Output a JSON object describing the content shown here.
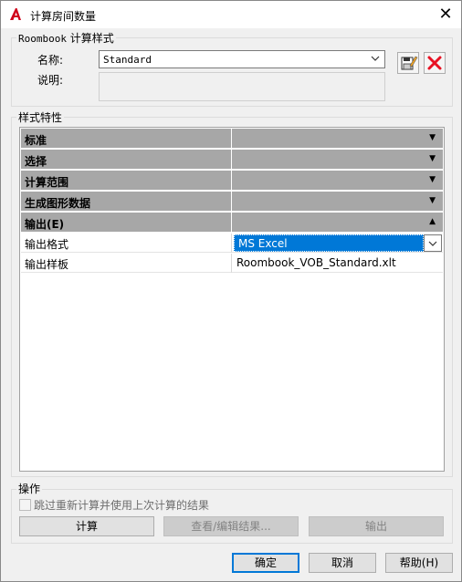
{
  "window": {
    "title": "计算房间数量",
    "close_glyph": "✕"
  },
  "style_group": {
    "legend_latin": "Roombook",
    "legend_cjk": " 计算样式",
    "name_label": "名称:",
    "name_value": "Standard",
    "desc_label": "说明:",
    "desc_value": ""
  },
  "properties_group": {
    "legend": "样式特性",
    "categories": [
      {
        "name": "标准",
        "expanded": false
      },
      {
        "name": "选择",
        "expanded": false
      },
      {
        "name": "计算范围",
        "expanded": false
      },
      {
        "name": "生成图形数据",
        "expanded": false
      },
      {
        "name": "输出(E)",
        "expanded": true
      }
    ],
    "output_props": [
      {
        "name": "输出格式",
        "value": "MS Excel"
      },
      {
        "name": "输出样板",
        "value": "Roombook_VOB_Standard.xlt"
      }
    ]
  },
  "operations_group": {
    "legend": "操作",
    "skip_label": "跳过重新计算并使用上次计算的结果",
    "skip_checked": false,
    "calc_button": "计算",
    "view_edit_button": "查看/编辑结果...",
    "export_button": "输出"
  },
  "footer": {
    "ok_button": "确定",
    "cancel_button": "取消",
    "help_button": "帮助(H)"
  },
  "colors": {
    "category_bg": "#a7a7a7",
    "selection_bg": "#0078d7",
    "delete_icon": "#e81123"
  }
}
